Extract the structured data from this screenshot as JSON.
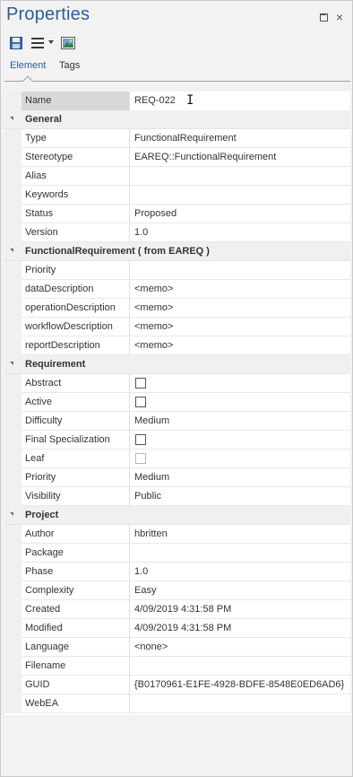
{
  "window": {
    "title": "Properties"
  },
  "tabs": [
    {
      "label": "Element"
    },
    {
      "label": "Tags"
    }
  ],
  "name_row": {
    "name": "Name",
    "value": "REQ-022"
  },
  "sections": [
    {
      "title": "General",
      "rows": [
        {
          "name": "Type",
          "value": "FunctionalRequirement"
        },
        {
          "name": "Stereotype",
          "value": "EAREQ::FunctionalRequirement"
        },
        {
          "name": "Alias",
          "value": ""
        },
        {
          "name": "Keywords",
          "value": ""
        },
        {
          "name": "Status",
          "value": "Proposed"
        },
        {
          "name": "Version",
          "value": "1.0"
        }
      ]
    },
    {
      "title": "FunctionalRequirement  ( from EAREQ )",
      "rows": [
        {
          "name": "Priority",
          "value": ""
        },
        {
          "name": "dataDescription",
          "value": "<memo>"
        },
        {
          "name": "operationDescription",
          "value": "<memo>"
        },
        {
          "name": "workflowDescription",
          "value": "<memo>"
        },
        {
          "name": "reportDescription",
          "value": "<memo>"
        }
      ]
    },
    {
      "title": "Requirement",
      "rows": [
        {
          "name": "Abstract",
          "checkbox": true,
          "checked": false
        },
        {
          "name": "Active",
          "checkbox": true,
          "checked": false
        },
        {
          "name": "Difficulty",
          "value": "Medium"
        },
        {
          "name": "Final Specialization",
          "checkbox": true,
          "checked": false
        },
        {
          "name": "Leaf",
          "checkbox": true,
          "checked": false,
          "disabled": true
        },
        {
          "name": "Priority",
          "value": "Medium"
        },
        {
          "name": "Visibility",
          "value": "Public"
        }
      ]
    },
    {
      "title": "Project",
      "rows": [
        {
          "name": "Author",
          "value": "hbritten"
        },
        {
          "name": "Package",
          "value": ""
        },
        {
          "name": "Phase",
          "value": "1.0"
        },
        {
          "name": "Complexity",
          "value": "Easy"
        },
        {
          "name": "Created",
          "value": "4/09/2019 4:31:58 PM"
        },
        {
          "name": "Modified",
          "value": "4/09/2019 4:31:58 PM"
        },
        {
          "name": "Language",
          "value": "<none>"
        },
        {
          "name": "Filename",
          "value": ""
        },
        {
          "name": "GUID",
          "value": "{B0170961-E1FE-4928-BDFE-8548E0ED6AD6}"
        },
        {
          "name": "WebEA",
          "value": ""
        }
      ]
    }
  ]
}
